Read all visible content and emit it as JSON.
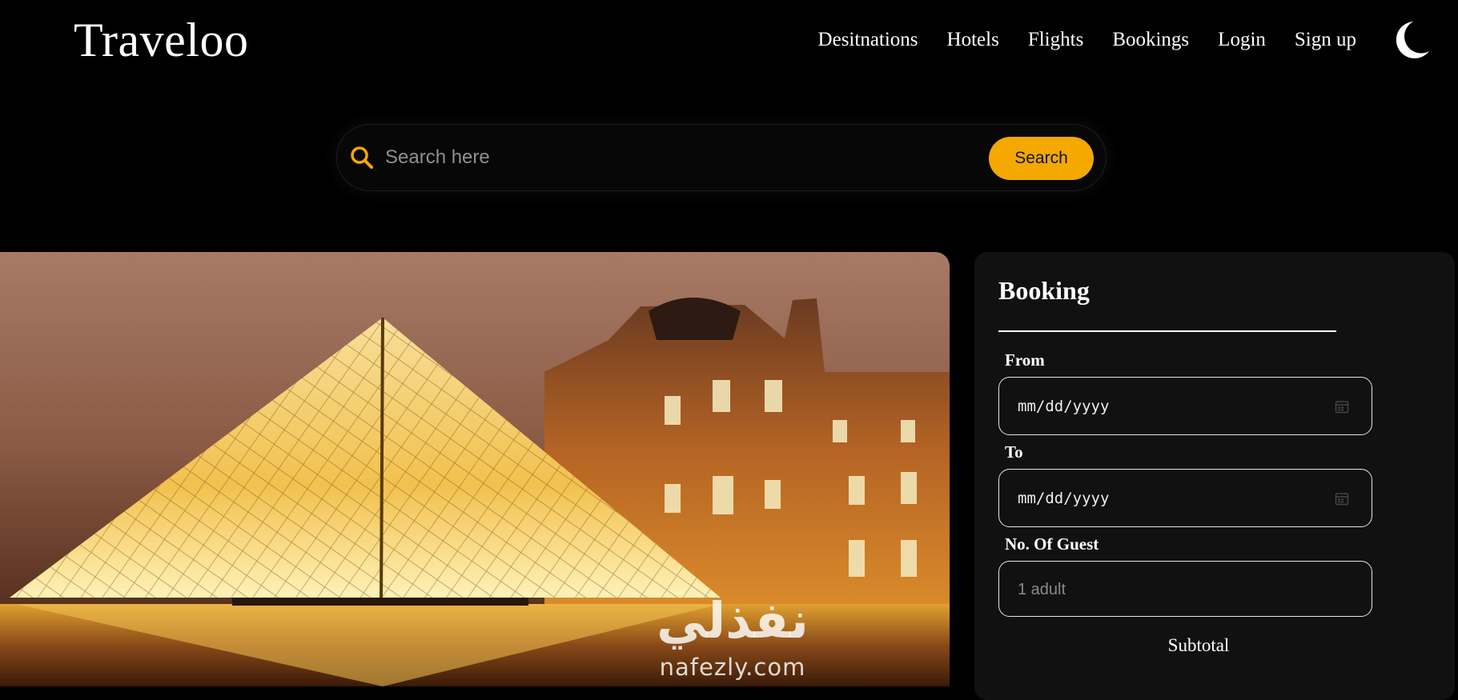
{
  "header": {
    "logo": "Traveloo",
    "nav": [
      "Desitnations",
      "Hotels",
      "Flights",
      "Bookings",
      "Login",
      "Sign up"
    ],
    "theme_toggle_icon": "moon-icon"
  },
  "search": {
    "placeholder": "Search here",
    "button_label": "Search",
    "icon": "search-icon",
    "accent_color": "#f4a800"
  },
  "hero": {
    "image": "louvre-pyramid-night-photo",
    "watermark_arabic": "نفذلي",
    "watermark_latin": "nafezly.com"
  },
  "booking": {
    "title": "Booking",
    "from_label": "From",
    "from_value": "mm/dd/yyyy",
    "to_label": "To",
    "to_value": "mm/dd/yyyy",
    "guest_label": "No. Of Guest",
    "guest_placeholder": "1 adult",
    "subtotal_label": "Subtotal",
    "calendar_icon": "calendar-icon"
  },
  "colors": {
    "background": "#000000",
    "panel": "#111111",
    "accent": "#f4a800",
    "text": "#ffffff"
  }
}
